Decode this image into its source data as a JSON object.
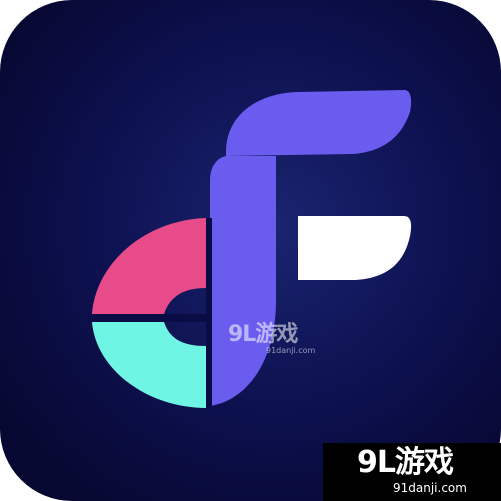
{
  "colors": {
    "tile_background": "#0a0b3a",
    "letter_f": "#6b5cf0",
    "f_lower_bar": "#ffffff",
    "ring_top": "#e84b8a",
    "ring_bottom": "#6ff5e4",
    "watermark_box": "#000000"
  },
  "watermark": {
    "brand": "9L游戏",
    "domain": "91danji.com"
  }
}
